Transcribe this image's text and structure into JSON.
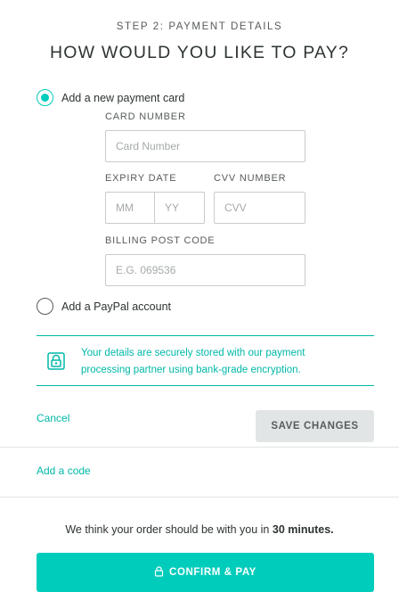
{
  "header": {
    "step": "STEP 2: PAYMENT DETAILS",
    "title": "HOW WOULD YOU LIKE TO PAY?"
  },
  "payment_options": {
    "card": {
      "label": "Add a new payment card",
      "selected": true
    },
    "paypal": {
      "label": "Add a PayPal account",
      "selected": false
    }
  },
  "card_form": {
    "card_number_label": "CARD NUMBER",
    "card_number_placeholder": "Card Number",
    "expiry_label": "EXPIRY DATE",
    "expiry_month_placeholder": "MM",
    "expiry_year_placeholder": "YY",
    "cvv_label": "CVV NUMBER",
    "cvv_placeholder": "CVV",
    "postcode_label": "BILLING POST CODE",
    "postcode_placeholder": "E.G. 069536"
  },
  "security_notice": {
    "icon": "lock-icon",
    "text": "Your details are securely stored with our payment processing partner using bank-grade encryption."
  },
  "actions": {
    "cancel_label": "Cancel",
    "save_label": "SAVE CHANGES",
    "add_code_label": "Add a code",
    "confirm_label": "CONFIRM & PAY"
  },
  "eta": {
    "prefix": "We think your order should be with you in",
    "time": "30 minutes."
  },
  "colors": {
    "accent": "#00ccbc",
    "accent_text": "#00b8a9",
    "text": "#2e3333",
    "muted": "#585c5c",
    "button_disabled": "#e2e5e5"
  }
}
